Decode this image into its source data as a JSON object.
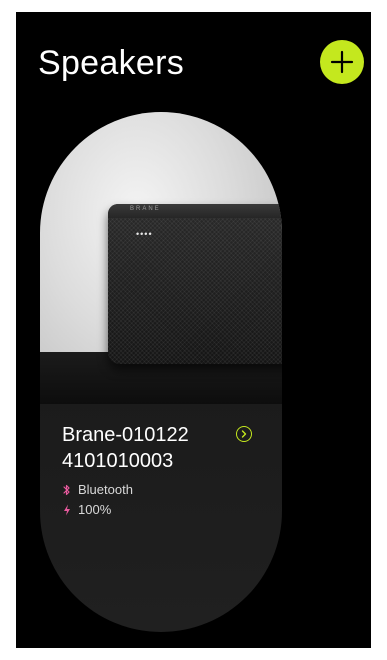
{
  "header": {
    "title": "Speakers",
    "add_icon": "plus-icon"
  },
  "speaker_card": {
    "brand_text": "BRANE",
    "led_text": "••••",
    "name_line1": "Brane-010122",
    "name_line2": "4101010003",
    "details_icon": "chevron-right-icon",
    "connection_icon": "bluetooth-icon",
    "connection": "Bluetooth",
    "battery_icon": "lightning-bolt-icon",
    "battery": "100%"
  },
  "colors": {
    "background": "#000000",
    "accent": "#c4e81e",
    "icon_pink": "#e85a9e",
    "text": "#ffffff"
  }
}
